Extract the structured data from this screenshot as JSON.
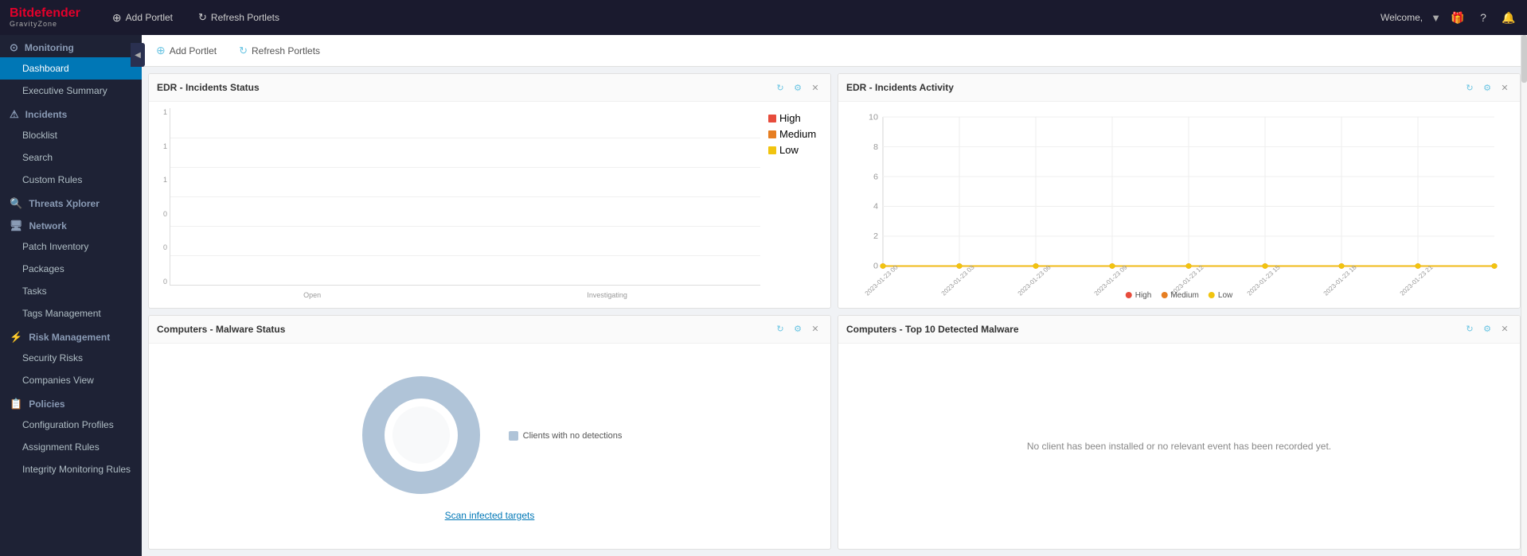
{
  "topbar": {
    "brand": "Bitdefender",
    "sub": "GravityZone",
    "add_portlet_label": "Add Portlet",
    "refresh_label": "Refresh Portlets",
    "welcome_label": "Welcome,"
  },
  "sidebar": {
    "collapse_icon": "◀",
    "sections": [
      {
        "id": "monitoring",
        "icon": "⊙",
        "label": "Monitoring",
        "items": [
          {
            "id": "dashboard",
            "label": "Dashboard",
            "active": true
          },
          {
            "id": "executive-summary",
            "label": "Executive Summary"
          }
        ]
      },
      {
        "id": "incidents",
        "icon": "⚠",
        "label": "Incidents",
        "items": [
          {
            "id": "blocklist",
            "label": "Blocklist"
          },
          {
            "id": "search",
            "label": "Search"
          },
          {
            "id": "custom-rules",
            "label": "Custom Rules"
          }
        ]
      },
      {
        "id": "threats-xplorer",
        "icon": "🔍",
        "label": "Threats Xplorer",
        "items": []
      },
      {
        "id": "network",
        "icon": "🖥",
        "label": "Network",
        "items": [
          {
            "id": "patch-inventory",
            "label": "Patch Inventory"
          },
          {
            "id": "packages",
            "label": "Packages"
          },
          {
            "id": "tasks",
            "label": "Tasks"
          },
          {
            "id": "tags-management",
            "label": "Tags Management"
          }
        ]
      },
      {
        "id": "risk-management",
        "icon": "⚡",
        "label": "Risk Management",
        "items": [
          {
            "id": "security-risks",
            "label": "Security Risks"
          },
          {
            "id": "companies-view",
            "label": "Companies View"
          }
        ]
      },
      {
        "id": "policies",
        "icon": "📋",
        "label": "Policies",
        "items": [
          {
            "id": "configuration-profiles",
            "label": "Configuration Profiles"
          },
          {
            "id": "assignment-rules",
            "label": "Assignment Rules"
          },
          {
            "id": "integrity-monitoring-rules",
            "label": "Integrity Monitoring Rules"
          }
        ]
      }
    ]
  },
  "portlets": [
    {
      "id": "edr-incidents-status",
      "title": "EDR - Incidents Status",
      "type": "bar-chart",
      "yaxis_labels": [
        "1",
        "1",
        "1",
        "0",
        "0",
        "0"
      ],
      "xaxis_labels": [
        "Open",
        "Investigating"
      ],
      "legend": [
        {
          "id": "high",
          "label": "High",
          "color": "#e74c3c"
        },
        {
          "id": "medium",
          "label": "Medium",
          "color": "#e67e22"
        },
        {
          "id": "low",
          "label": "Low",
          "color": "#f1c40f"
        }
      ]
    },
    {
      "id": "edr-incidents-activity",
      "title": "EDR - Incidents Activity",
      "type": "line-chart",
      "yaxis_labels": [
        "10",
        "8",
        "6",
        "4",
        "2",
        "0"
      ],
      "xaxis_labels": [
        "2023-01-23 00",
        "2023-01-23 03",
        "2023-01-23 06",
        "2023-01-23 09",
        "2023-01-23 12",
        "2023-01-23 15",
        "2023-01-23 18",
        "2023-01-23 21"
      ],
      "legend": [
        {
          "id": "high",
          "label": "High",
          "color": "#e74c3c"
        },
        {
          "id": "medium",
          "label": "Medium",
          "color": "#e67e22"
        },
        {
          "id": "low",
          "label": "Low",
          "color": "#f1c40f"
        }
      ],
      "series": {
        "high": [
          0,
          0,
          0,
          0,
          0,
          0,
          0,
          0
        ],
        "medium": [
          0,
          0,
          0,
          0,
          0,
          0,
          0,
          0
        ],
        "low": [
          0,
          0,
          0,
          0,
          0,
          0,
          0,
          0
        ]
      }
    },
    {
      "id": "computers-malware-status",
      "title": "Computers - Malware Status",
      "type": "donut",
      "legend": [
        {
          "id": "no-detections",
          "label": "Clients with no detections",
          "color": "#b0c4d8"
        }
      ],
      "scan_link_label": "Scan infected targets"
    },
    {
      "id": "computers-top10-malware",
      "title": "Computers - Top 10 Detected Malware",
      "type": "table",
      "no_data_msg": "No client has been installed or no relevant event has been recorded yet."
    }
  ],
  "colors": {
    "accent": "#0077b6",
    "sidebar_bg": "#1e2235",
    "sidebar_active": "#0077b6",
    "topbar_bg": "#1a1a2e",
    "brand_red": "#e4002b"
  }
}
